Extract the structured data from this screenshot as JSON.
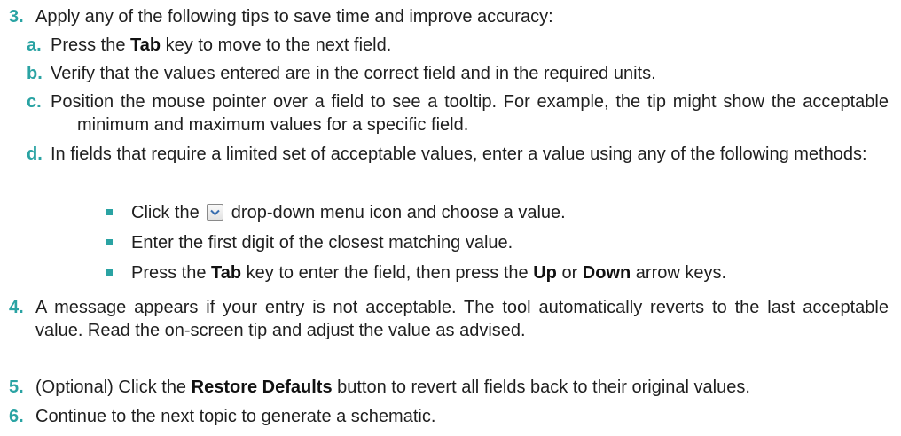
{
  "steps": [
    {
      "number": "3.",
      "text": "Apply any of the following tips to save time and improve accuracy:",
      "substeps": [
        {
          "letter": "a.",
          "parts": [
            "Press the ",
            "Tab",
            " key to move to the next field."
          ]
        },
        {
          "letter": "b.",
          "text": "Verify that the values entered are in the correct field and in the required units."
        },
        {
          "letter": "c.",
          "text": "Position the mouse pointer over a field to see a tooltip. For example, the tip might show the acceptable minimum and maximum values for a specific field."
        },
        {
          "letter": "d.",
          "text": "In fields that require a limited set of acceptable values, enter a value using any of the following methods:",
          "bullets": [
            {
              "before": "Click the ",
              "icon": "chevron-down-icon",
              "after": " drop-down menu icon and choose a value."
            },
            {
              "text": "Enter the first digit of the closest matching value."
            },
            {
              "parts": [
                "Press the ",
                "Tab",
                " key to enter the field, then press the ",
                "Up",
                " or ",
                "Down",
                " arrow keys."
              ]
            }
          ]
        }
      ]
    },
    {
      "number": "4.",
      "text": "A message appears if your entry is not acceptable. The tool automatically reverts to the last acceptable value. Read the on-screen tip and adjust the value as advised."
    },
    {
      "number": "5.",
      "parts": [
        "(Optional) Click the ",
        "Restore Defaults",
        " button to revert all fields back to their original values."
      ]
    },
    {
      "number": "6.",
      "text": "Continue to the next topic to generate a schematic."
    }
  ],
  "colors": {
    "accent": "#2aa3a3",
    "text": "#1f1f1f"
  }
}
